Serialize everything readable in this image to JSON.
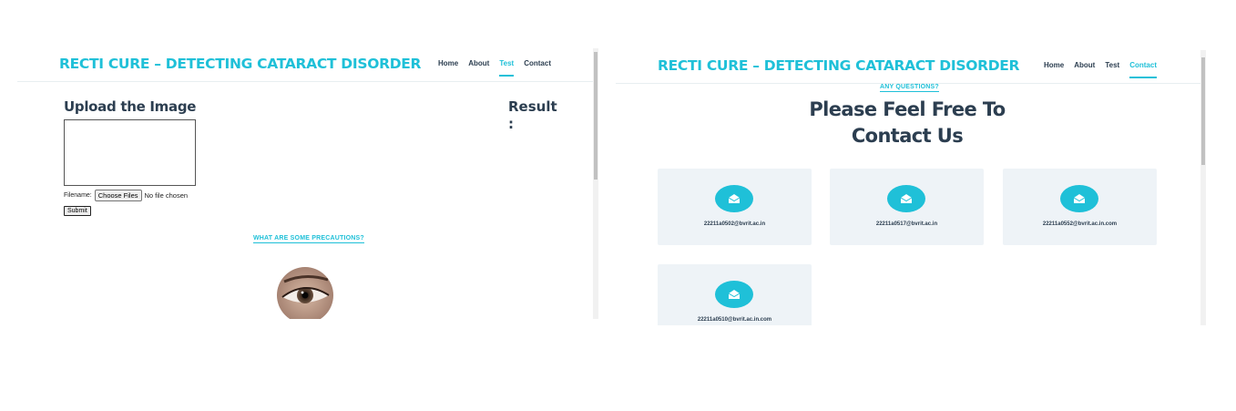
{
  "left": {
    "brand": "RECTI CURE – DETECTING CATARACT DISORDER",
    "nav": [
      "Home",
      "About",
      "Test",
      "Contact"
    ],
    "active_nav": "Test",
    "upload_title": "Upload the Image",
    "filename_label": "Filename:",
    "choose_files": "Choose Files",
    "no_file": "No file chosen",
    "submit": "Submit",
    "result_label": "Result :",
    "precautions_link": "WHAT ARE SOME PRECAUTIONS?"
  },
  "right": {
    "brand": "RECTI CURE – DETECTING CATARACT DISORDER",
    "nav": [
      "Home",
      "About",
      "Test",
      "Contact"
    ],
    "active_nav": "Contact",
    "subheading": "ANY QUESTIONS?",
    "heading_line1": "Please Feel Free To",
    "heading_line2": "Contact Us",
    "contacts": [
      "22211a0502@bvrit.ac.in",
      "22211a0517@bvrit.ac.in",
      "22211a0552@bvrit.ac.in.com",
      "22211a0510@bvrit.ac.in.com"
    ]
  },
  "colors": {
    "accent": "#1fc0d8",
    "heading": "#2c3e50",
    "card_bg": "#eef3f7"
  },
  "icons": {
    "contact_card": "envelope-open-icon",
    "upload_preview": "eye-photo"
  }
}
